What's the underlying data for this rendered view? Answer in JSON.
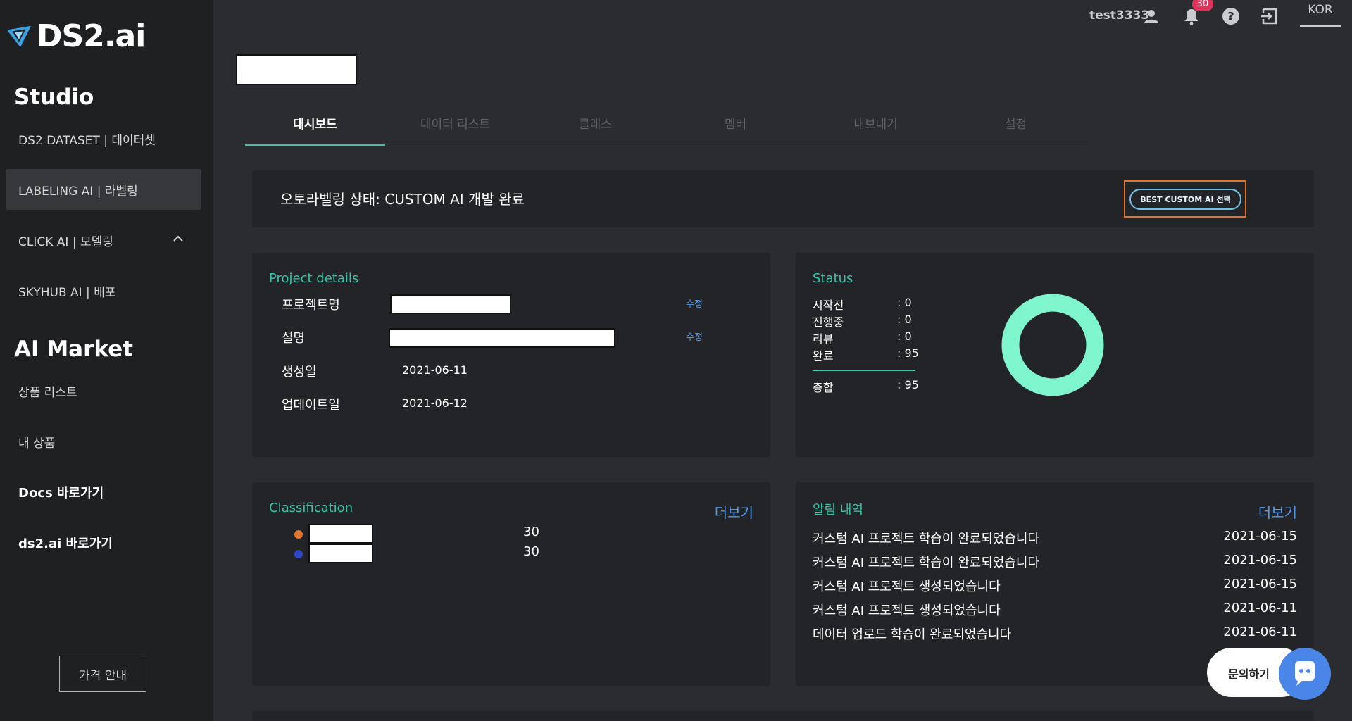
{
  "brand": {
    "logo_text": "DS2.ai",
    "accent": "#36c5a9"
  },
  "sidebar": {
    "studio_title": "Studio",
    "items": [
      {
        "label": "DS2 DATASET | 데이터셋"
      },
      {
        "label": "LABELING AI | 라벨링"
      },
      {
        "label": "CLICK AI | 모델링"
      },
      {
        "label": "SKYHUB AI | 배포"
      }
    ],
    "market_title": "AI Market",
    "market_items": [
      {
        "label": "상품 리스트"
      },
      {
        "label": "내 상품"
      }
    ],
    "links": [
      {
        "label": "Docs 바로가기"
      },
      {
        "label": "ds2.ai 바로가기"
      }
    ],
    "price_button": "가격 안내"
  },
  "header": {
    "username": "test3333",
    "notification_count": "30",
    "language": "KOR"
  },
  "tabs": [
    {
      "label": "대시보드"
    },
    {
      "label": "데이터 리스트"
    },
    {
      "label": "클래스"
    },
    {
      "label": "멤버"
    },
    {
      "label": "내보내기"
    },
    {
      "label": "설정"
    }
  ],
  "status_strip": {
    "text": "오토라벨링 상태: CUSTOM AI 개발 완료",
    "button": "BEST CUSTOM AI 선택"
  },
  "project_details": {
    "title": "Project details",
    "name_label": "프로젝트명",
    "desc_label": "설명",
    "created_label": "생성일",
    "created_value": "2021-06-11",
    "updated_label": "업데이트일",
    "updated_value": "2021-06-12",
    "edit_label": "수정"
  },
  "status": {
    "title": "Status",
    "rows": [
      {
        "label": "시작전",
        "value": ": 0"
      },
      {
        "label": "진행중",
        "value": ": 0"
      },
      {
        "label": "리뷰",
        "value": ": 0"
      },
      {
        "label": "완료",
        "value": ": 95"
      }
    ],
    "total_label": "총합",
    "total_value": ": 95",
    "donut_color": "#7ff5cd",
    "completed_fraction": 1.0
  },
  "classification": {
    "title": "Classification",
    "more": "더보기",
    "items": [
      {
        "color": "#e2752c",
        "count": "30"
      },
      {
        "color": "#2f45c8",
        "count": "30"
      }
    ]
  },
  "notifications": {
    "title": "알림 내역",
    "more": "더보기",
    "items": [
      {
        "message": "커스텀 AI 프로젝트 학습이 완료되었습니다",
        "date": "2021-06-15"
      },
      {
        "message": "커스텀 AI 프로젝트 학습이 완료되었습니다",
        "date": "2021-06-15"
      },
      {
        "message": "커스텀 AI 프로젝트 생성되었습니다",
        "date": "2021-06-15"
      },
      {
        "message": "커스텀 AI 프로젝트 생성되었습니다",
        "date": "2021-06-11"
      },
      {
        "message": "데이터 업로드 학습이 완료되었습니다",
        "date": "2021-06-11"
      }
    ]
  },
  "chat": {
    "label": "문의하기"
  }
}
